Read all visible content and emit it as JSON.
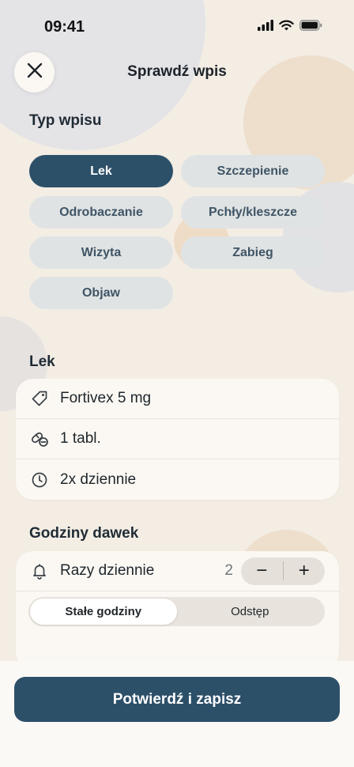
{
  "status_bar": {
    "time": "09:41"
  },
  "header": {
    "title": "Sprawdź wpis"
  },
  "entry_type": {
    "label": "Typ wpisu",
    "chips": [
      {
        "label": "Lek",
        "active": true
      },
      {
        "label": "Szczepienie",
        "active": false
      },
      {
        "label": "Odrobaczanie",
        "active": false
      },
      {
        "label": "Pchły/kleszcze",
        "active": false
      },
      {
        "label": "Wizyta",
        "active": false
      },
      {
        "label": "Zabieg",
        "active": false
      },
      {
        "label": "Objaw",
        "active": false
      }
    ]
  },
  "medicine": {
    "label": "Lek",
    "rows": [
      {
        "icon": "tag-icon",
        "text": "Fortivex 5 mg"
      },
      {
        "icon": "pill-icon",
        "text": "1 tabl."
      },
      {
        "icon": "clock-icon",
        "text": "2x dziennie"
      }
    ]
  },
  "doses": {
    "label": "Godziny dawek",
    "times_per_day_label": "Razy dziennie",
    "times_per_day_value": "2",
    "stepper_minus": "−",
    "stepper_plus": "+",
    "segments": [
      {
        "label": "Stałe godziny",
        "active": true
      },
      {
        "label": "Odstęp",
        "active": false
      }
    ]
  },
  "footer": {
    "confirm_label": "Potwierdź i zapisz"
  },
  "colors": {
    "accent": "#2d5069",
    "chip_bg": "#e0e3e4",
    "page_bg": "#f3ede4"
  }
}
